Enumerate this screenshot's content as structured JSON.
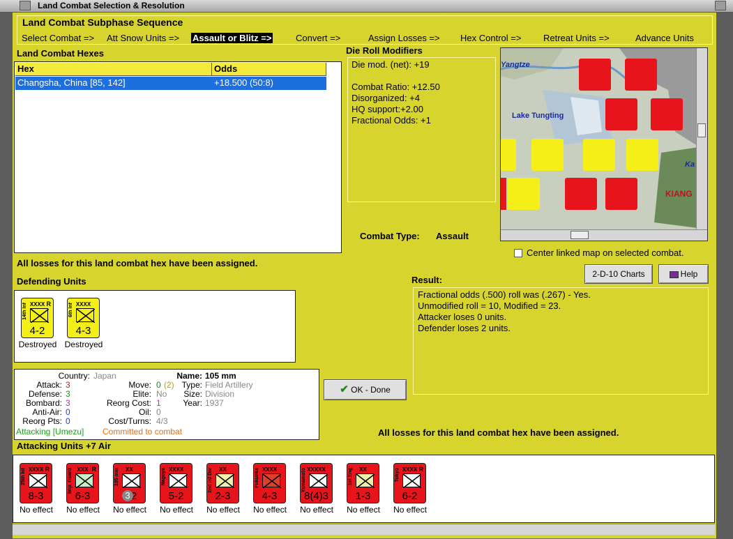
{
  "window": {
    "title": "Land Combat Selection & Resolution"
  },
  "sequence": {
    "title": "Land Combat Subphase Sequence",
    "steps": [
      {
        "label": "Select Combat =>"
      },
      {
        "label": "Att Snow Units =>"
      },
      {
        "label": "Assault or Blitz =>",
        "active": true
      },
      {
        "label": "Convert =>"
      },
      {
        "label": "Assign Losses =>"
      },
      {
        "label": "Hex Control =>"
      },
      {
        "label": "Retreat Units =>"
      },
      {
        "label": "Advance Units"
      }
    ]
  },
  "combat_hexes": {
    "title": "Land Combat Hexes",
    "columns": [
      "Hex",
      "Odds"
    ],
    "rows": [
      {
        "hex": "Changsha, China [85, 142]",
        "odds": "+18.500 (50:8)"
      }
    ]
  },
  "die_roll_modifiers": {
    "title": "Die Roll Modifiers",
    "lines": [
      "Die mod. (net): +19",
      "",
      "Combat Ratio: +12.50",
      "Disorganized: +4",
      "HQ support:+2.00",
      "Fractional Odds: +1"
    ]
  },
  "combat_type": {
    "label": "Combat Type:",
    "value": "Assault"
  },
  "map": {
    "labels": [
      "Yangtze",
      "Lake Tungting",
      "KIANG",
      "Ka"
    ],
    "center_linked_label": "Center linked map on selected combat.",
    "center_linked_checked": false
  },
  "losses_msg_top": "All losses for this land combat hex have been assigned.",
  "losses_msg_bottom": "All losses for this land combat hex have been assigned.",
  "buttons": {
    "charts": "2-D-10 Charts",
    "help": "Help",
    "ok": "OK - Done"
  },
  "defending": {
    "title": "Defending Units",
    "units": [
      {
        "name": "14th Inf",
        "size": "XXXX",
        "reserve": "R",
        "strength": "4-2",
        "status": "Destroyed"
      },
      {
        "name": "6th Inf",
        "size": "XXXX",
        "reserve": "",
        "strength": "4-3",
        "status": "Destroyed"
      }
    ]
  },
  "result": {
    "title": "Result:",
    "lines": [
      "Fractional odds (.500) roll was (.267)  - Yes.",
      "Unmodified roll = 10, Modified = 23.",
      "Attacker loses 0 units.",
      "Defender loses 2 units."
    ]
  },
  "unit_info": {
    "country_label": "Country:",
    "country": "Japan",
    "attack_label": "Attack:",
    "attack": "3",
    "defense_label": "Defense:",
    "defense": "3",
    "bombard_label": "Bombard:",
    "bombard": "3",
    "antiair_label": "Anti-Air:",
    "antiair": "0",
    "reorg_pts_label": "Reorg Pts:",
    "reorg_pts": "0",
    "move_label": "Move:",
    "move": "0",
    "move_extra": "(2)",
    "elite_label": "Elite:",
    "elite": "No",
    "reorg_cost_label": "Reorg Cost:",
    "reorg_cost": "1",
    "oil_label": "Oil:",
    "oil": "0",
    "cost_turns_label": "Cost/Turns:",
    "cost_turns": "4/3",
    "name_label": "Name:",
    "name": "105 mm",
    "type_label": "Type:",
    "type": "Field Artillery",
    "size_label": "Size:",
    "size": "Division",
    "year_label": "Year:",
    "year": "1937",
    "attacking": "Attacking [Umezu]",
    "committed": "Committed to combat"
  },
  "attacking": {
    "title": "Attacking Units +7 Air",
    "units": [
      {
        "name": "25th Inf",
        "size": "XXXX",
        "reserve": "R",
        "strength": "8-3",
        "status": "No effect",
        "fill": "#ffffff"
      },
      {
        "name": "Imp. Guard",
        "size": "XXX",
        "reserve": "R",
        "strength": "6-3",
        "status": "No effect",
        "fill": "#c8f0c8"
      },
      {
        "name": "105 mm",
        "size": "XX",
        "reserve": "",
        "strength": "3-2",
        "badge": "3",
        "status": "No effect",
        "fill": "#ffffff"
      },
      {
        "name": "Nagoya",
        "size": "XXXX",
        "reserve": "",
        "strength": "5-2",
        "status": "No effect",
        "fill": "#ffffff"
      },
      {
        "name": "2nd Inf Div",
        "size": "XX",
        "reserve": "",
        "strength": "2-3",
        "status": "No effect",
        "fill": "#f0f0a8"
      },
      {
        "name": "Fukuoka",
        "size": "XXXX",
        "reserve": "",
        "strength": "4-3",
        "status": "No effect",
        "fill": "#e0402a"
      },
      {
        "name": "Yamamoto",
        "size": "XXXXX",
        "reserve": "",
        "strength": "8(4)3",
        "status": "No effect",
        "fill": "#ffffff"
      },
      {
        "name": "1st Eng",
        "size": "XX",
        "reserve": "",
        "strength": "1-3",
        "status": "No effect",
        "fill": "#f0f0a8"
      },
      {
        "name": "Tokyo",
        "size": "XXXX",
        "reserve": "R",
        "strength": "6-2",
        "status": "No effect",
        "fill": "#ffffff"
      }
    ]
  },
  "colors": {
    "panel": "#d8d42e",
    "japan_red": "#e8141c",
    "china_yellow": "#f4ef16",
    "select_blue": "#1d6fe0",
    "attack_red": "#e0141c",
    "defense_green": "#1b8a1b",
    "bombard_magenta": "#d01ad0",
    "antiair_blue": "#1f3fd8"
  }
}
